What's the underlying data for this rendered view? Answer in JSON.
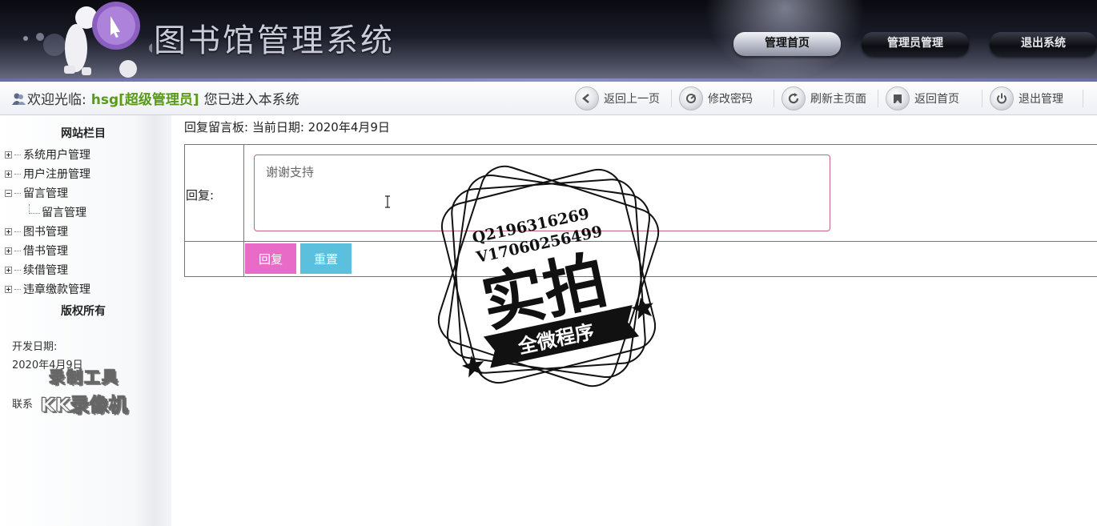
{
  "header": {
    "title": "图书馆管理系统",
    "nav": [
      {
        "label": "管理首页",
        "active": true
      },
      {
        "label": "管理员管理",
        "active": false
      },
      {
        "label": "退出系统",
        "active": false
      }
    ]
  },
  "toolbar": {
    "welcome_prefix": "欢迎光临:",
    "username": "hsg[超级管理员]",
    "welcome_suffix": "您已进入本系统",
    "items": [
      {
        "label": "返回上一页",
        "icon": "arrow-left-icon"
      },
      {
        "label": "修改密码",
        "icon": "key-icon"
      },
      {
        "label": "刷新主页面",
        "icon": "refresh-icon"
      },
      {
        "label": "返回首页",
        "icon": "home-icon"
      },
      {
        "label": "退出管理",
        "icon": "power-icon"
      }
    ]
  },
  "sidebar": {
    "section_title": "网站栏目",
    "menu": [
      {
        "label": "系统用户管理",
        "expanded": false
      },
      {
        "label": "用户注册管理",
        "expanded": false
      },
      {
        "label": "留言管理",
        "expanded": true,
        "children": [
          "留言管理"
        ]
      },
      {
        "label": "图书管理",
        "expanded": false
      },
      {
        "label": "借书管理",
        "expanded": false
      },
      {
        "label": "续借管理",
        "expanded": false
      },
      {
        "label": "违章缴款管理",
        "expanded": false
      }
    ],
    "copyright_title": "版权所有",
    "dev_date_label": "开发日期:",
    "dev_date_value": "2020年4月9日",
    "contact_label": "联系"
  },
  "main": {
    "heading": "回复留言板: 当前日期: 2020年4月9日",
    "reply_label": "回复:",
    "reply_value": "谢谢支持",
    "submit_label": "回复",
    "reset_label": "重置"
  },
  "overlay": {
    "stamp_line1": "Q2196316269",
    "stamp_line2": "V17060256499",
    "stamp_main": "实拍",
    "stamp_banner": "全微程序",
    "watermark_line1": "录制工具",
    "watermark_line2": "KK录像机"
  },
  "colors": {
    "username": "#5a9a1a",
    "submit_button": "#e96bc8",
    "reset_button": "#5bc0de",
    "textarea_border": "#c8657a"
  }
}
